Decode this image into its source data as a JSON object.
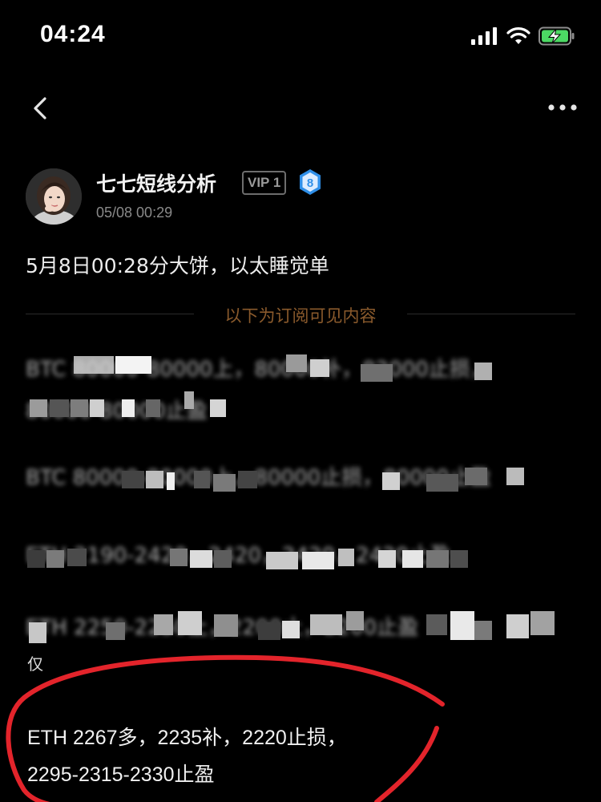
{
  "status_bar": {
    "time": "04:24"
  },
  "nav": {
    "back_icon": "chevron-left-icon",
    "more_icon": "more-horizontal-icon"
  },
  "author": {
    "name": "七七短线分析",
    "vip": "VIP 1",
    "level": "8",
    "timestamp": "05/08 00:29"
  },
  "post": {
    "title": "5月8日00:28分大饼，以太睡觉单",
    "subscriber_divider": "以下为订阅可见内容",
    "blurred_lines": [
      "BTC 80000-80000上，80000补，82000止损，",
      "80000-80000止盈",
      "BTC 80000-80000上，80000止损，80000止盈",
      "ETH 2190-2420，2420，2420，2420止盈",
      "ETH 2250-2250上，2200止，2200止盈"
    ],
    "partial_char": "仅",
    "eth_line1": "ETH 2267多，2235补，2220止损，",
    "eth_line2": "2295-2315-2330止盈"
  },
  "colors": {
    "background": "#000000",
    "divider_text": "#8a5a2c",
    "annotation": "#e3242b",
    "level_badge": "#2f8fe8",
    "battery": "#4cd964"
  }
}
